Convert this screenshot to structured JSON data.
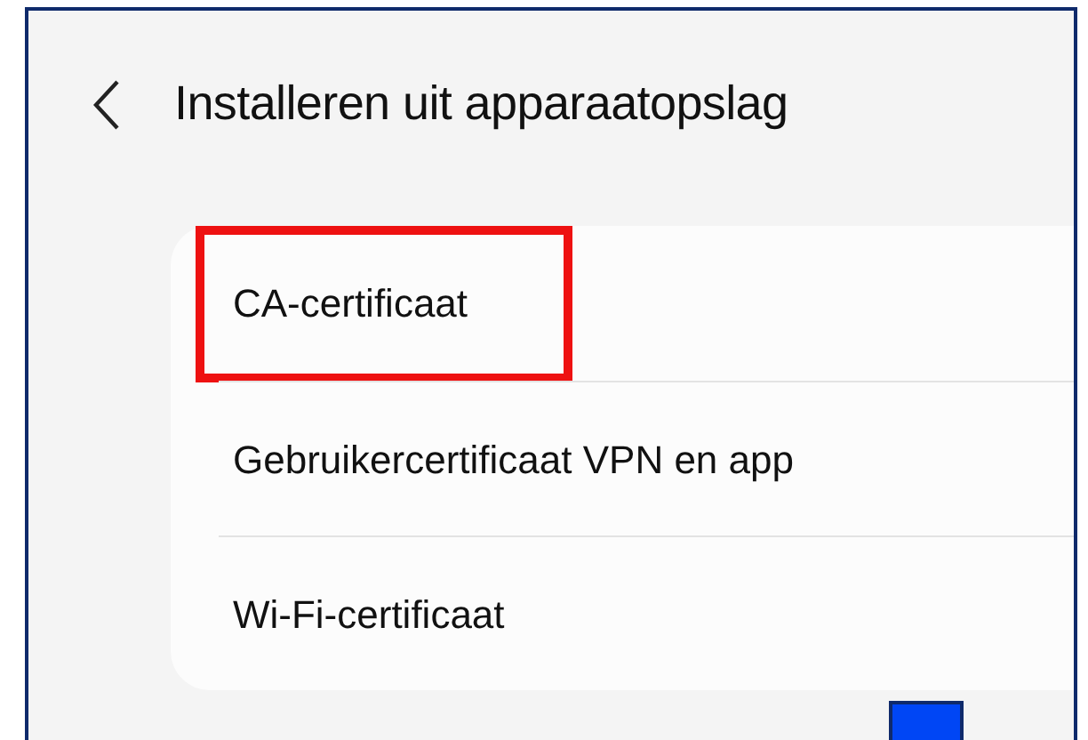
{
  "header": {
    "title": "Installeren uit apparaatopslag"
  },
  "items": [
    {
      "label": "CA-certificaat",
      "highlighted": true
    },
    {
      "label": "Gebruikercertificaat VPN en app",
      "highlighted": false
    },
    {
      "label": "Wi-Fi-certificaat",
      "highlighted": false
    }
  ]
}
